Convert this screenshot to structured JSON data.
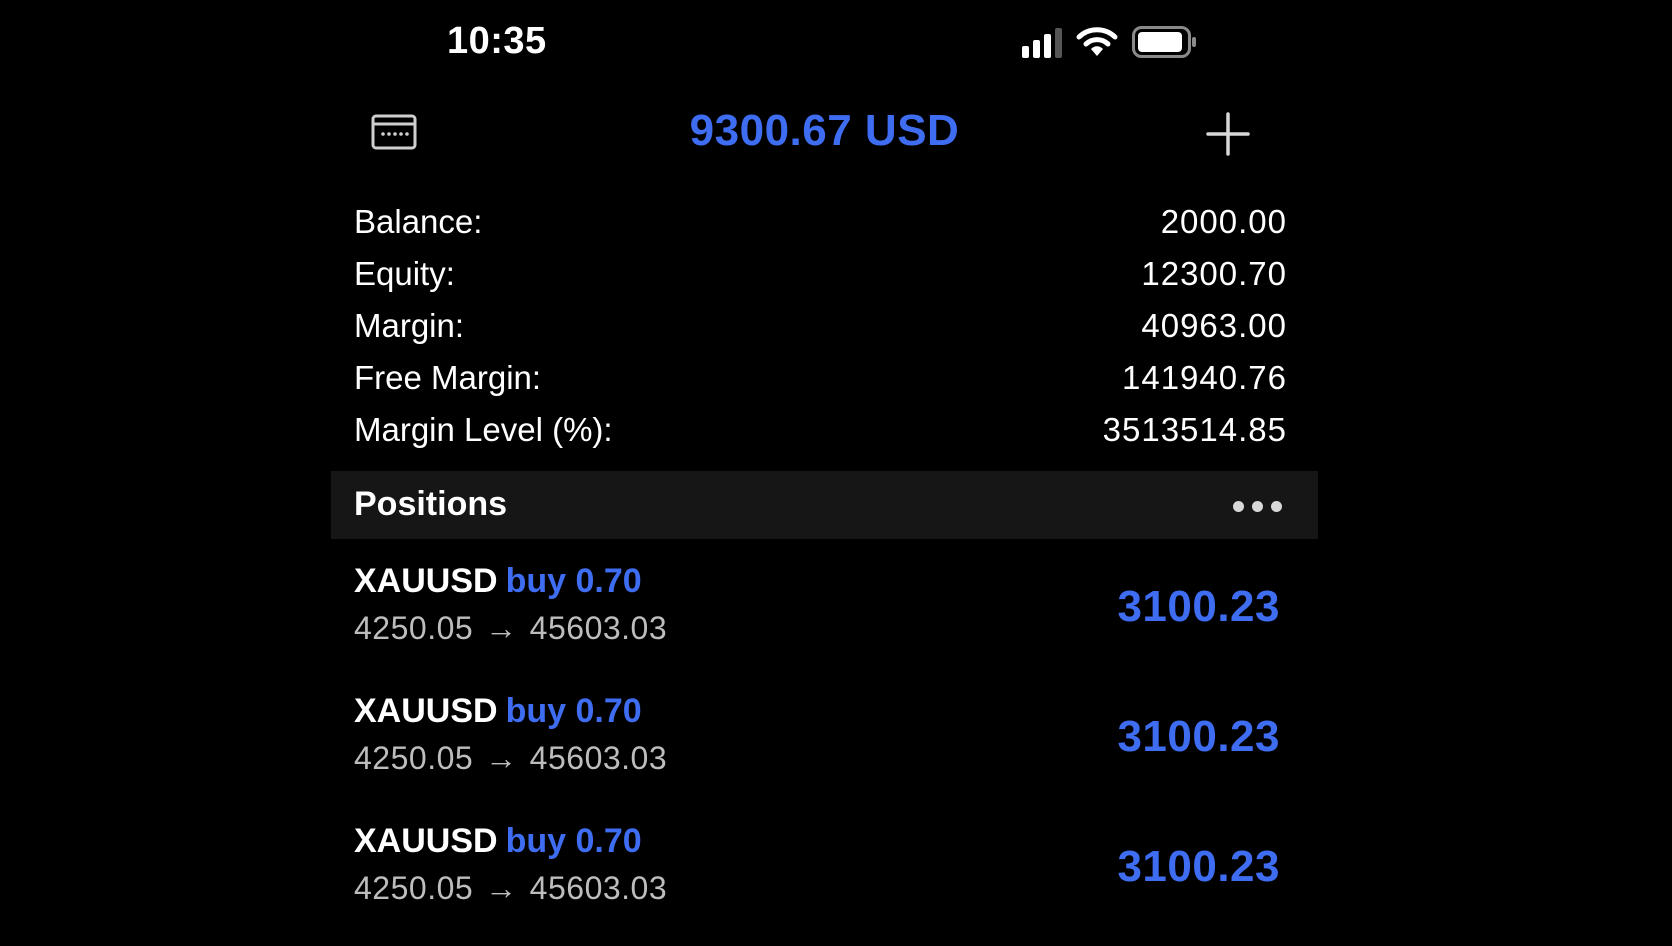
{
  "status_bar": {
    "time": "10:35",
    "icons": [
      "cellular-signal-icon",
      "wifi-icon",
      "battery-icon"
    ]
  },
  "header": {
    "title": "9300.67 USD",
    "left_icon": "wallet-icon",
    "right_icon": "add-icon"
  },
  "summary": {
    "rows": [
      {
        "label": "Balance:",
        "value": "2000.00"
      },
      {
        "label": "Equity:",
        "value": "12300.70"
      },
      {
        "label": "Margin:",
        "value": "40963.00"
      },
      {
        "label": "Free Margin:",
        "value": "141940.76"
      },
      {
        "label": "Margin Level (%):",
        "value": "3513514.85"
      }
    ]
  },
  "positions": {
    "title": "Positions",
    "menu_icon": "more-icon",
    "items": [
      {
        "symbol": "XAUUSD",
        "side": "buy 0.70",
        "open_price": "4250.05",
        "arrow": "→",
        "current_price": "45603.03",
        "profit": "3100.23"
      },
      {
        "symbol": "XAUUSD",
        "side": "buy 0.70",
        "open_price": "4250.05",
        "arrow": "→",
        "current_price": "45603.03",
        "profit": "3100.23"
      },
      {
        "symbol": "XAUUSD",
        "side": "buy 0.70",
        "open_price": "4250.05",
        "arrow": "→",
        "current_price": "45603.03",
        "profit": "3100.23"
      }
    ]
  },
  "colors": {
    "background": "#000000",
    "accent_blue": "#3f6df2",
    "section_header_bg": "#161616",
    "secondary_text": "#bdbdbd"
  }
}
